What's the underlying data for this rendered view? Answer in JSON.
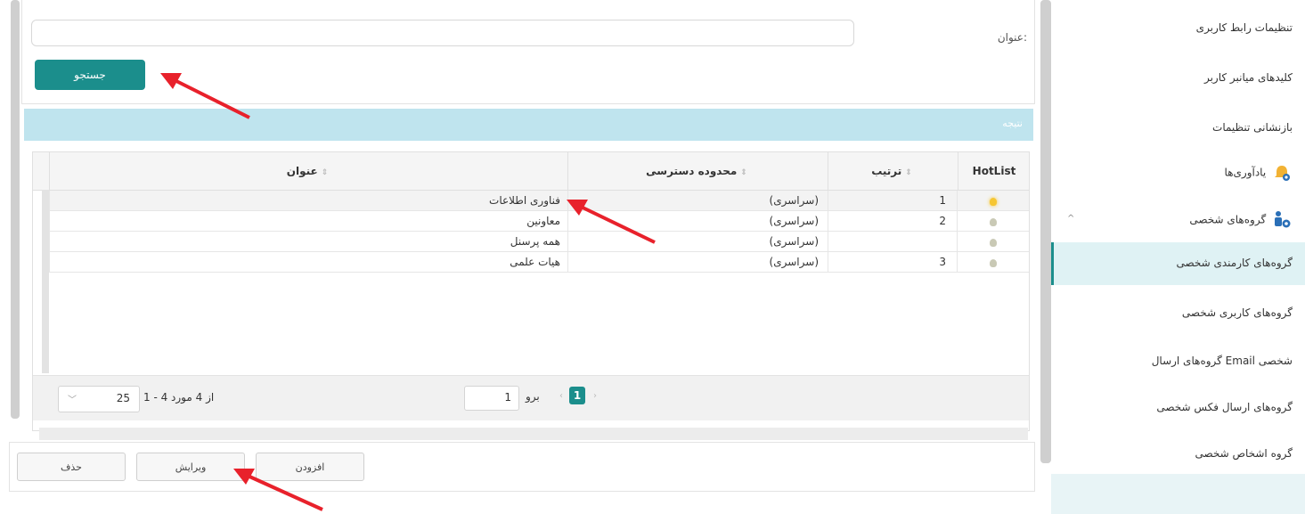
{
  "search": {
    "title_label": "عنوان:",
    "title_value": "",
    "search_button": "جستجو"
  },
  "result": {
    "header": "نتیجه",
    "columns": {
      "hotlist": "HotList",
      "order": "ترتیب",
      "scope": "محدوده دسترسی",
      "title": "عنوان"
    },
    "rows": [
      {
        "title": "فناوری اطلاعات",
        "scope": "(سراسری)",
        "order": "1",
        "hot": true
      },
      {
        "title": "معاونین",
        "scope": "(سراسری)",
        "order": "2",
        "hot": false
      },
      {
        "title": "همه پرسنل",
        "scope": "(سراسری)",
        "order": "",
        "hot": false
      },
      {
        "title": "هیات علمی",
        "scope": "(سراسری)",
        "order": "3",
        "hot": false
      }
    ]
  },
  "pager": {
    "page_size": "25",
    "items_summary": "1 - 4 از 4 مورد",
    "goto_label": "برو",
    "goto_value": "1",
    "current_page": "1",
    "prev": "‹",
    "next": "›"
  },
  "actions": {
    "add": "افزودن",
    "edit": "ویرایش",
    "delete": "حذف"
  },
  "sidebar": {
    "items": [
      {
        "label": "تنظیمات رابط کاربری"
      },
      {
        "label": "کلیدهای میانبر کاربر"
      },
      {
        "label": "بازنشانی تنظیمات"
      },
      {
        "label": "یادآوری‌ها"
      },
      {
        "label": "گروه‌های شخصی"
      },
      {
        "label": "گروه‌های کارمندی شخصی"
      },
      {
        "label": "گروه‌های کاربری شخصی"
      },
      {
        "label": "گروه‌های ارسال Email شخصی"
      },
      {
        "label": "گروه‌های ارسال فکس شخصی"
      },
      {
        "label": "گروه اشخاص شخصی"
      }
    ],
    "active_index": 5,
    "chevron": "^"
  },
  "colors": {
    "accent": "#1b8e8c",
    "result_header": "#bfe4ee",
    "arrow": "#e8212b"
  }
}
